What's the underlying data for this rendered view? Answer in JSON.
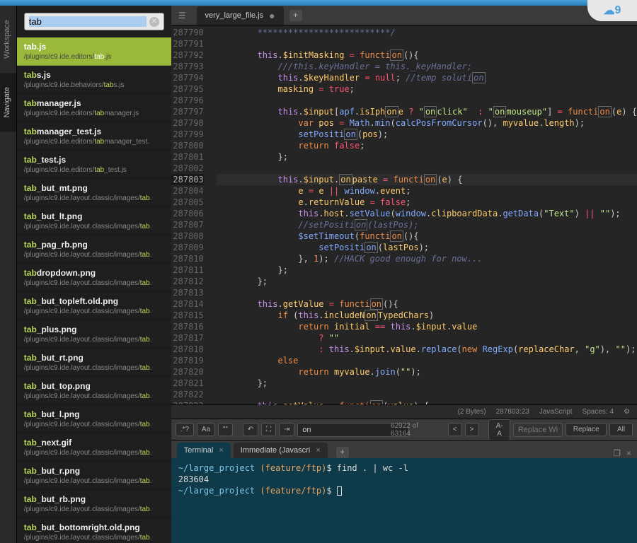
{
  "sideTabs": {
    "workspace": "Workspace",
    "navigate": "Navigate"
  },
  "search": {
    "value": "tab",
    "placeholder": ""
  },
  "results": [
    {
      "name_pre": "",
      "name_hl": "tab",
      "name_post": ".js",
      "path_pre": "/plugins/c9.ide.editors/",
      "path_hl": "tab",
      "path_post": ".js",
      "selected": true
    },
    {
      "name_pre": "",
      "name_hl": "tab",
      "name_post": "s.js",
      "path_pre": "/plugins/c9.ide.behaviors/",
      "path_hl": "tab",
      "path_post": "s.js"
    },
    {
      "name_pre": "",
      "name_hl": "tab",
      "name_post": "manager.js",
      "path_pre": "/plugins/c9.ide.editors/",
      "path_hl": "tab",
      "path_post": "manager.js"
    },
    {
      "name_pre": "",
      "name_hl": "tab",
      "name_post": "manager_test.js",
      "path_pre": "/plugins/c9.ide.editors/",
      "path_hl": "tab",
      "path_post": "manager_test."
    },
    {
      "name_pre": "",
      "name_hl": "tab",
      "name_post": "_test.js",
      "path_pre": "/plugins/c9.ide.editors/",
      "path_hl": "tab",
      "path_post": "_test.js"
    },
    {
      "name_pre": "",
      "name_hl": "tab",
      "name_post": "_but_mt.png",
      "path_pre": "/plugins/c9.ide.layout.classic/images/",
      "path_hl": "tab",
      "path_post": "."
    },
    {
      "name_pre": "",
      "name_hl": "tab",
      "name_post": "_but_lt.png",
      "path_pre": "/plugins/c9.ide.layout.classic/images/",
      "path_hl": "tab",
      "path_post": "."
    },
    {
      "name_pre": "",
      "name_hl": "tab",
      "name_post": "_pag_rb.png",
      "path_pre": "/plugins/c9.ide.layout.classic/images/",
      "path_hl": "tab",
      "path_post": "."
    },
    {
      "name_pre": "",
      "name_hl": "tab",
      "name_post": "dropdown.png",
      "path_pre": "/plugins/c9.ide.layout.classic/images/",
      "path_hl": "tab",
      "path_post": "."
    },
    {
      "name_pre": "",
      "name_hl": "tab",
      "name_post": "_but_topleft.old.png",
      "path_pre": "/plugins/c9.ide.layout.classic/images/",
      "path_hl": "tab",
      "path_post": "."
    },
    {
      "name_pre": "",
      "name_hl": "tab",
      "name_post": "_plus.png",
      "path_pre": "/plugins/c9.ide.layout.classic/images/",
      "path_hl": "tab",
      "path_post": "."
    },
    {
      "name_pre": "",
      "name_hl": "tab",
      "name_post": "_but_rt.png",
      "path_pre": "/plugins/c9.ide.layout.classic/images/",
      "path_hl": "tab",
      "path_post": "."
    },
    {
      "name_pre": "",
      "name_hl": "tab",
      "name_post": "_but_top.png",
      "path_pre": "/plugins/c9.ide.layout.classic/images/",
      "path_hl": "tab",
      "path_post": "."
    },
    {
      "name_pre": "",
      "name_hl": "tab",
      "name_post": "_but_l.png",
      "path_pre": "/plugins/c9.ide.layout.classic/images/",
      "path_hl": "tab",
      "path_post": "."
    },
    {
      "name_pre": "",
      "name_hl": "tab",
      "name_post": "_next.gif",
      "path_pre": "/plugins/c9.ide.layout.classic/images/",
      "path_hl": "tab",
      "path_post": "."
    },
    {
      "name_pre": "",
      "name_hl": "tab",
      "name_post": "_but_r.png",
      "path_pre": "/plugins/c9.ide.layout.classic/images/",
      "path_hl": "tab",
      "path_post": "."
    },
    {
      "name_pre": "",
      "name_hl": "tab",
      "name_post": "_but_rb.png",
      "path_pre": "/plugins/c9.ide.layout.classic/images/",
      "path_hl": "tab",
      "path_post": "."
    },
    {
      "name_pre": "",
      "name_hl": "tab",
      "name_post": "_but_bottomright.old.png",
      "path_pre": "/plugins/c9.ide.layout.classic/images/",
      "path_hl": "tab",
      "path_post": "."
    }
  ],
  "tabs": {
    "file": "very_large_file.js"
  },
  "gutter_start": 287790,
  "gutter_count": 34,
  "current_line": 287803,
  "status": {
    "bytes": "(2 Bytes)",
    "pos": "287803:23",
    "lang": "JavaScript",
    "spaces": "Spaces: 4"
  },
  "searchbar": {
    "find": "on",
    "count": "62922 of 63164",
    "replace_ph": "Replace With",
    "replace_btn": "Replace",
    "all_btn": "All",
    "regex": ".*?",
    "case": "Aa",
    "word": "\"\"",
    "font": "A-A"
  },
  "term_tabs": {
    "terminal": "Terminal",
    "immediate": "Immediate (Javascri"
  },
  "terminal": {
    "l1_path": "~/large_project",
    "l1_branch": "(feature/ftp)",
    "l1_cmd": "$ find . | wc -l",
    "l2": "283604",
    "l3_path": "~/large_project",
    "l3_branch": "(feature/ftp)",
    "l3_cmd": "$ "
  },
  "badge": "9"
}
